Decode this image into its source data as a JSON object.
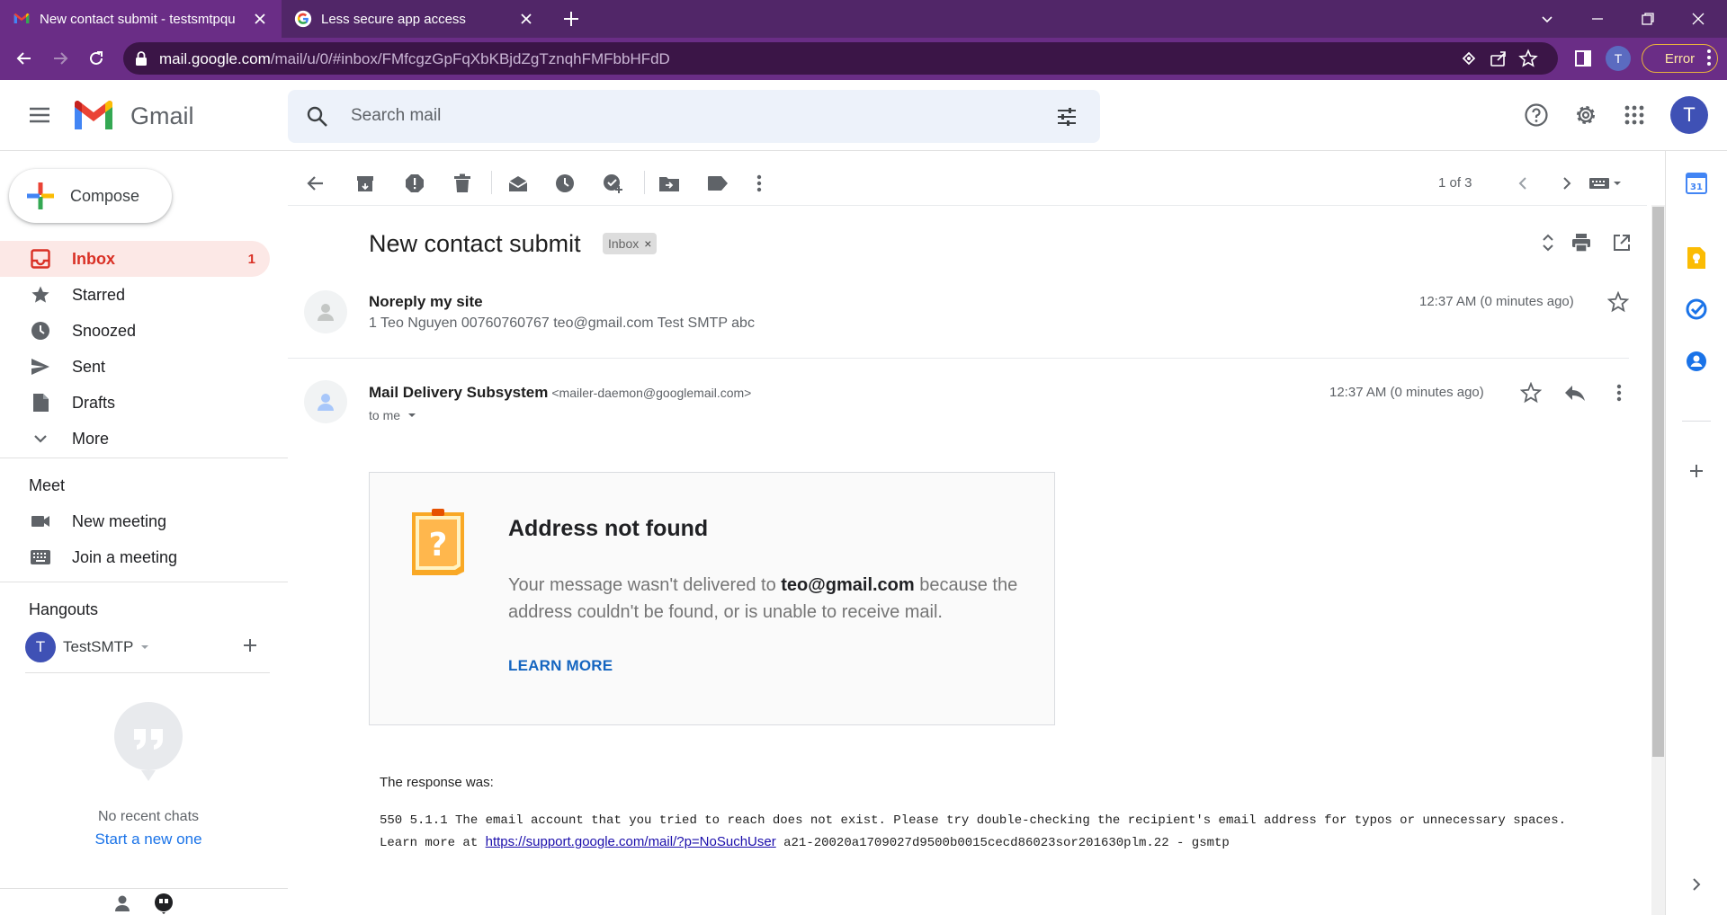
{
  "browser": {
    "tabs": [
      {
        "title": "New contact submit - testsmtpqu",
        "active": true
      },
      {
        "title": "Less secure app access",
        "active": false
      }
    ],
    "url_host": "mail.google.com",
    "url_path": "/mail/u/0/#inbox/FMfcgzGpFqXbKBjdZgTznqhFMFbbHFdD",
    "profile_initial": "T",
    "error_label": "Error"
  },
  "gmail": {
    "product_name": "Gmail",
    "search_placeholder": "Search mail",
    "avatar_initial": "T"
  },
  "sidebar": {
    "compose_label": "Compose",
    "nav": [
      {
        "label": "Inbox",
        "count": "1",
        "icon": "inbox-icon"
      },
      {
        "label": "Starred",
        "icon": "star-icon"
      },
      {
        "label": "Snoozed",
        "icon": "clock-icon"
      },
      {
        "label": "Sent",
        "icon": "send-icon"
      },
      {
        "label": "Drafts",
        "icon": "draft-icon"
      },
      {
        "label": "More",
        "icon": "chevron-down-icon"
      }
    ],
    "meet": {
      "title": "Meet",
      "items": [
        {
          "label": "New meeting",
          "icon": "video-icon"
        },
        {
          "label": "Join a meeting",
          "icon": "keyboard-icon"
        }
      ]
    },
    "hangouts": {
      "title": "Hangouts",
      "user": "TestSMTP",
      "user_initial": "T",
      "no_chats": "No recent chats",
      "start_new": "Start a new one"
    }
  },
  "toolbar": {
    "pager": "1 of 3"
  },
  "thread": {
    "subject": "New contact submit",
    "label": "Inbox",
    "messages": [
      {
        "sender": "Noreply my site",
        "snippet": "1 Teo Nguyen 00760760767 teo@gmail.com Test SMTP abc",
        "time": "12:37 AM (0 minutes ago)"
      },
      {
        "sender": "Mail Delivery Subsystem",
        "sender_email": "<mailer-daemon@googlemail.com>",
        "to": "to me",
        "time": "12:37 AM (0 minutes ago)"
      }
    ],
    "bounce": {
      "title": "Address not found",
      "text_before": "Your message wasn't delivered to ",
      "address": "teo@gmail.com",
      "text_after": " because the address couldn't be found, or is unable to receive mail.",
      "learn_more": "LEARN MORE"
    },
    "response": {
      "label": "The response was:",
      "body_before": "550 5.1.1 The email account that you tried to reach does not exist. Please try double-checking the recipient's email address for typos or unnecessary spaces. Learn more at ",
      "link": "https://support.google.com/mail/?p=NoSuchUser",
      "body_after": " a21-20020a1709027d9500b0015cecd86023sor201630plm.22 - gsmtp"
    }
  },
  "colors": {
    "chrome_frame": "#512668",
    "chrome_toolbar": "#6a2d86",
    "gmail_red": "#d93025",
    "link_blue": "#1a73e8"
  }
}
